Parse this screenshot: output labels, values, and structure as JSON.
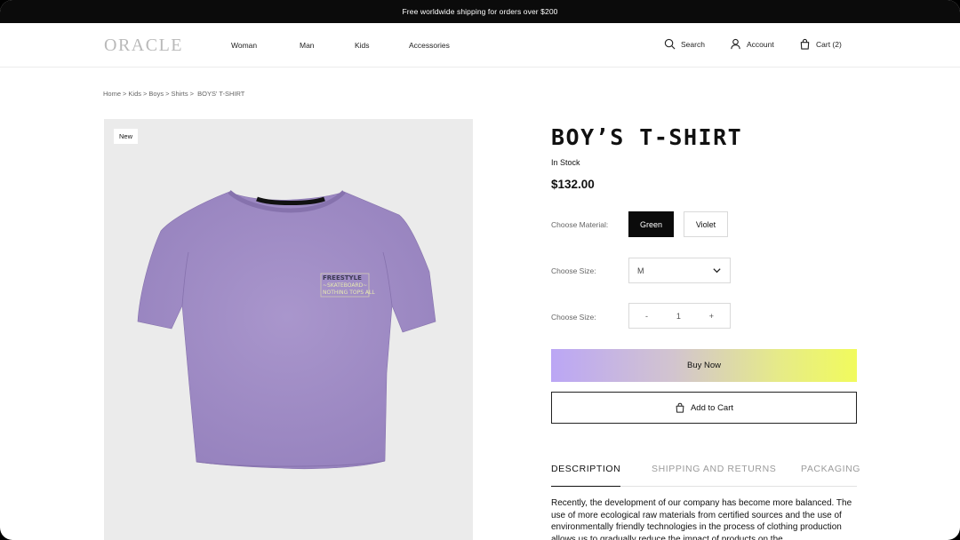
{
  "promo": {
    "text": "Free worldwide shipping for orders over $200"
  },
  "header": {
    "logo": "ORACLE",
    "nav": [
      {
        "label": "Woman"
      },
      {
        "label": "Man"
      },
      {
        "label": "Kids"
      },
      {
        "label": "Accessories"
      }
    ],
    "search_label": "Search",
    "account_label": "Account",
    "cart_label": "Cart (2)",
    "icons": {
      "search": "search-icon",
      "account": "user-icon",
      "cart": "shopping-bag-icon"
    }
  },
  "breadcrumb": [
    "Home",
    "Kids",
    "Boys",
    "Shirts",
    "BOYS' T-SHIRT"
  ],
  "breadcrumb_separator": ">",
  "product": {
    "badge": "New",
    "title": "BOY’S T-SHIRT",
    "stock": "In Stock",
    "price": "$132.00",
    "material_label": "Choose Material:",
    "materials": [
      "Green",
      "Violet"
    ],
    "selected_material": "Green",
    "size_label": "Choose Size:",
    "size_value": "M",
    "quantity_label": "Choose Size:",
    "quantity_minus": "-",
    "quantity_value": "1",
    "quantity_plus": "+",
    "buy_label": "Buy Now",
    "add_to_cart_label": "Add to Cart",
    "shirt_color": "#a38fc6"
  },
  "tabs": [
    {
      "label": "DESCRIPTION",
      "active": true
    },
    {
      "label": "SHIPPING AND RETURNS",
      "active": false
    },
    {
      "label": "PACKAGING",
      "active": false
    }
  ],
  "description": "Recently, the development of our company has become more balanced. The use of more ecological raw materials from certified sources and the use of environmentally friendly technologies in the process of clothing production allows us to gradually reduce the impact of products on the",
  "colors": {
    "promo_bg": "#0b0b0b",
    "accent_dark": "#0b0b0b",
    "buy_gradient_start": "#bba6f5",
    "buy_gradient_end": "#f1fb5d"
  }
}
